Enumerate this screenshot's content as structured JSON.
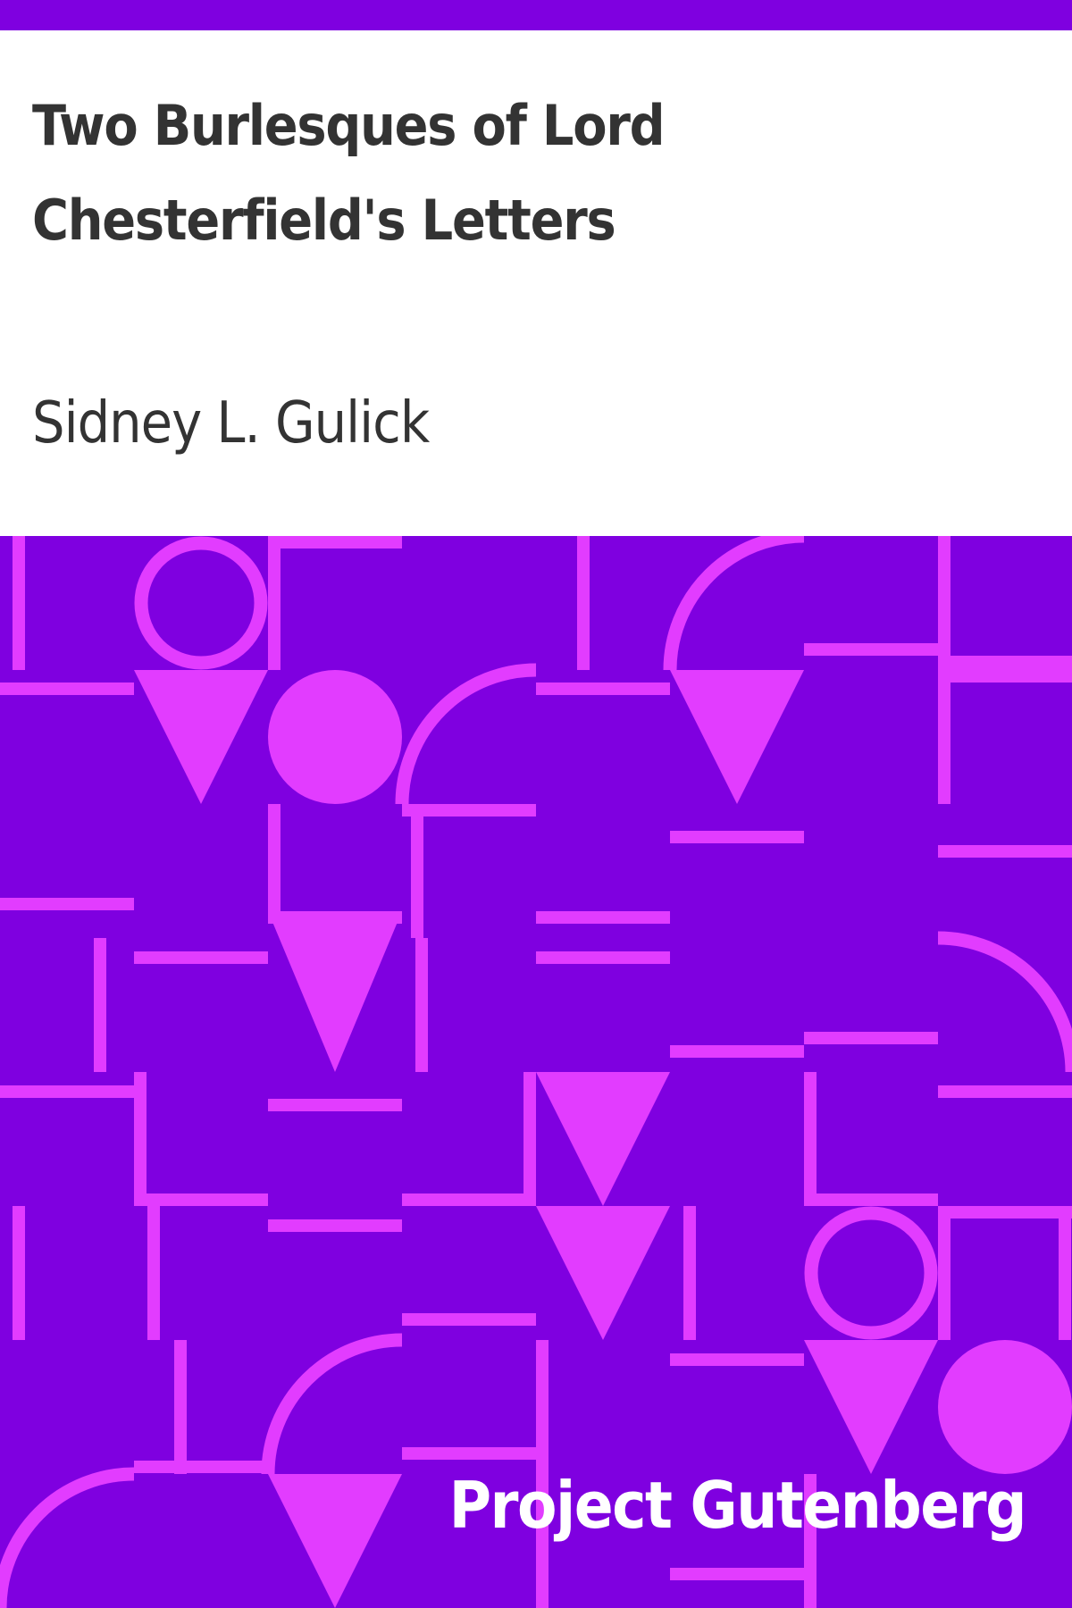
{
  "cover": {
    "title": "Two Burlesques of Lord Chesterfield's Letters",
    "author": "Sidney L. Gulick",
    "publisher": "Project Gutenberg"
  },
  "colors": {
    "background": "#ffffff",
    "band": "#7f00e0",
    "pattern_background": "#7f00e0",
    "pattern_shapes": "#e23cff",
    "title_text": "#333333",
    "publisher_text": "#ffffff"
  }
}
